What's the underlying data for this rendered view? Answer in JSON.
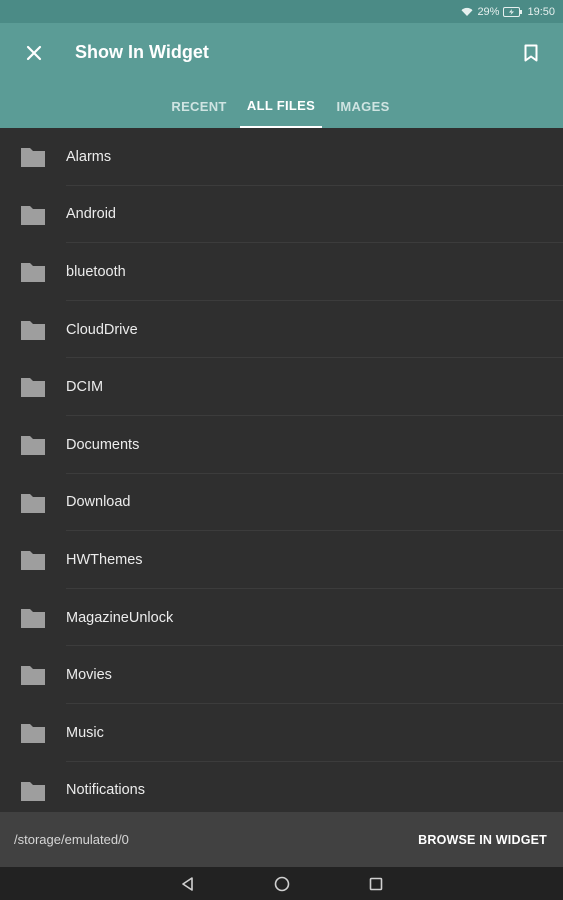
{
  "status_bar": {
    "battery_percent": "29%",
    "time": "19:50"
  },
  "app_bar": {
    "title": "Show In Widget",
    "icons": {
      "close": "close-icon",
      "bookmark": "bookmark-icon"
    }
  },
  "tabs": [
    {
      "label": "RECENT",
      "selected": false
    },
    {
      "label": "ALL FILES",
      "selected": true
    },
    {
      "label": "IMAGES",
      "selected": false
    }
  ],
  "files": [
    {
      "name": "Alarms"
    },
    {
      "name": "Android"
    },
    {
      "name": "bluetooth"
    },
    {
      "name": "CloudDrive"
    },
    {
      "name": "DCIM"
    },
    {
      "name": "Documents"
    },
    {
      "name": "Download"
    },
    {
      "name": "HWThemes"
    },
    {
      "name": "MagazineUnlock"
    },
    {
      "name": "Movies"
    },
    {
      "name": "Music"
    },
    {
      "name": "Notifications"
    }
  ],
  "bottom_bar": {
    "path": "/storage/emulated/0",
    "browse_label": "BROWSE IN WIDGET"
  },
  "colors": {
    "app_bar": "#5b9c96",
    "status_bar": "#4b8b86",
    "background": "#2f2f2f",
    "folder_icon": "#9e9e9e"
  }
}
